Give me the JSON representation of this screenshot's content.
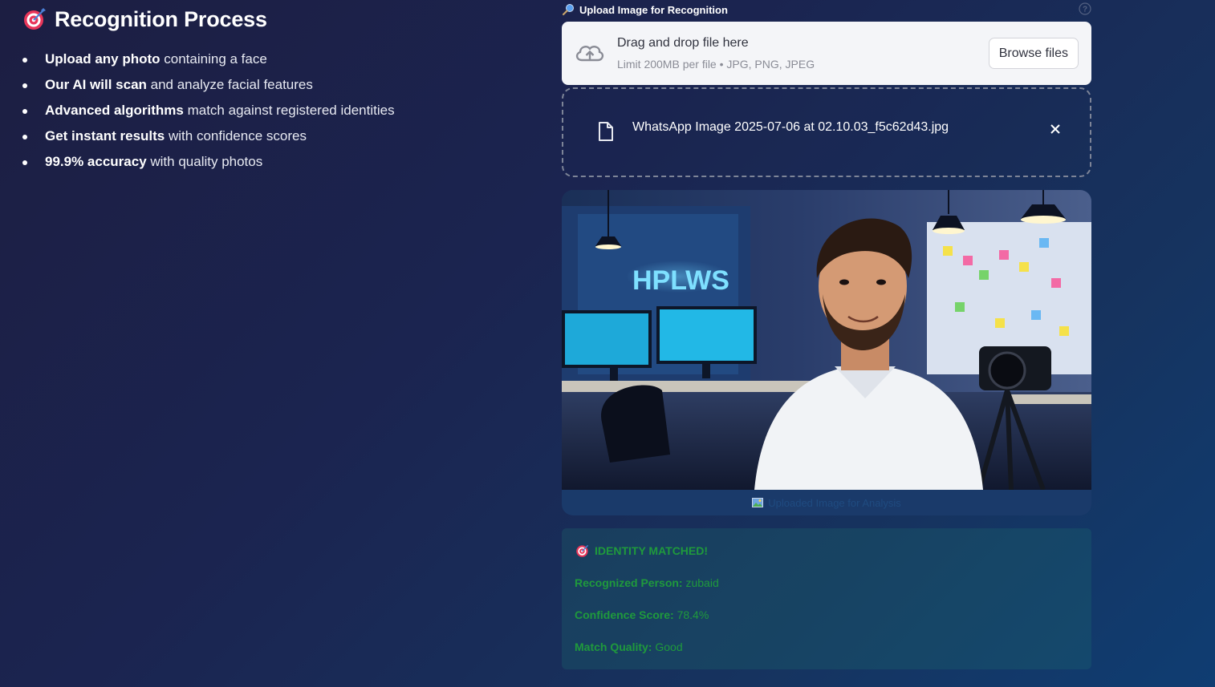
{
  "left": {
    "title": "Recognition Process",
    "title_icon": "target-icon",
    "steps": [
      {
        "bold": "Upload any photo",
        "rest": " containing a face"
      },
      {
        "bold": "Our AI will scan",
        "rest": " and analyze facial features"
      },
      {
        "bold": "Advanced algorithms",
        "rest": " match against registered identities"
      },
      {
        "bold": "Get instant results",
        "rest": " with confidence scores"
      },
      {
        "bold": "99.9% accuracy",
        "rest": " with quality photos"
      }
    ]
  },
  "uploader": {
    "label": "Upload Image for Recognition",
    "label_icon": "magnifier-icon",
    "drop_title": "Drag and drop file here",
    "drop_limit": "Limit 200MB per file • JPG, PNG, JPEG",
    "browse_label": "Browse files",
    "file_name": "WhatsApp Image 2025-07-06 at 02.10.03_f5c62d43.jpg"
  },
  "image": {
    "caption": "Uploaded Image for Analysis",
    "alt": "Photo of a smiling man in a white shirt in an office with monitors and a camera on a tripod"
  },
  "result": {
    "heading": "IDENTITY MATCHED!",
    "person_label": "Recognized Person:",
    "person_value": "zubaid",
    "confidence_label": "Confidence Score:",
    "confidence_value": "78.4%",
    "quality_label": "Match Quality:",
    "quality_value": "Good"
  },
  "colors": {
    "success_text": "#1f9a3c",
    "dropzone_bg": "#f4f5f8",
    "accent": "#e8365a"
  }
}
